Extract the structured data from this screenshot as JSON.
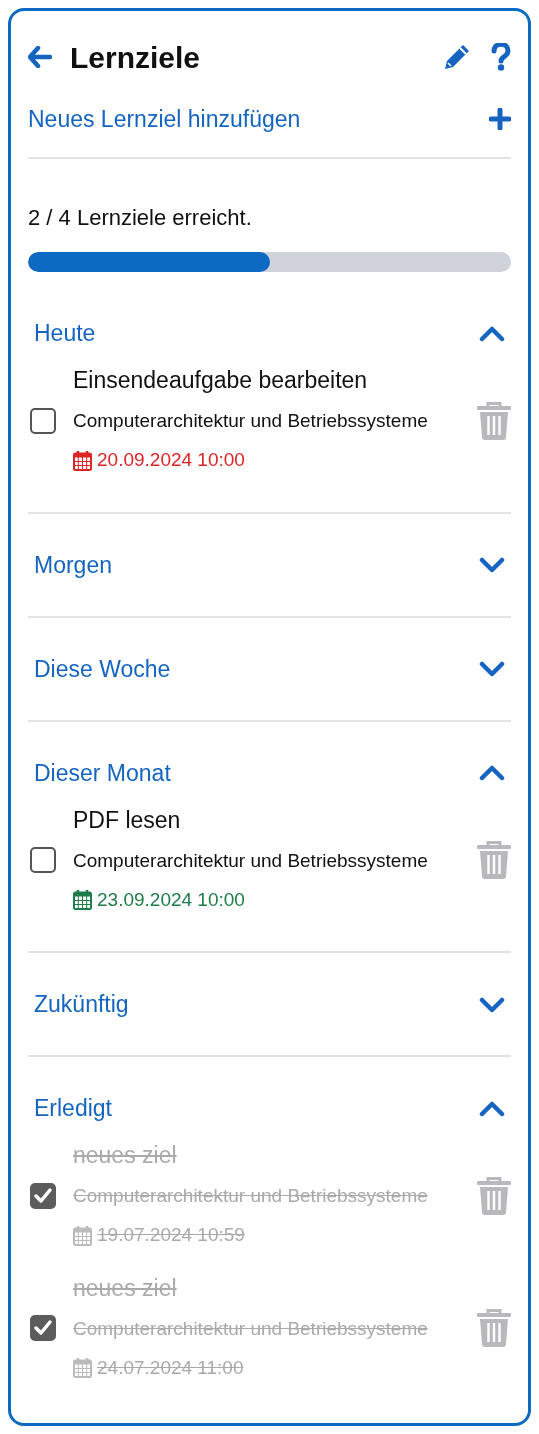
{
  "header": {
    "title": "Lernziele"
  },
  "add_link": "Neues Lernziel hinzufügen",
  "progress": {
    "text": "2 / 4 Lernziele erreicht.",
    "level": 0.5
  },
  "sections": [
    {
      "title": "Heute",
      "expanded": true,
      "goals": [
        {
          "title": "Einsendeaufgabe bearbeiten",
          "course": "Computerarchitektur und Betriebssysteme",
          "date": "20.09.2024 10:00",
          "color": "#dc2626",
          "done": false
        }
      ]
    },
    {
      "title": "Morgen",
      "expanded": false
    },
    {
      "title": "Diese Woche",
      "expanded": false
    },
    {
      "title": "Dieser Monat",
      "expanded": true,
      "goals": [
        {
          "title": "PDF lesen",
          "course": "Computerarchitektur und Betriebssysteme",
          "date": "23.09.2024 10:00",
          "color": "#1e7d4a",
          "done": false
        }
      ]
    },
    {
      "title": "Zukünftig",
      "expanded": false
    },
    {
      "title": "Erledigt",
      "expanded": true,
      "goals": [
        {
          "title": "neues ziel",
          "course": "Computerarchitektur und Betriebssysteme",
          "date": "19.07.2024 10:59",
          "done": true
        },
        {
          "title": "neues ziel",
          "course": "Computerarchitektur und Betriebssysteme",
          "date": "24.07.2024 11:00",
          "done": true
        }
      ]
    }
  ]
}
